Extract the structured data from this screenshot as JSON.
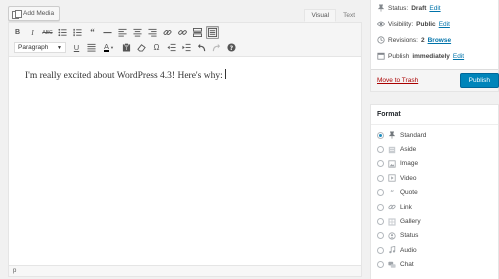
{
  "editor": {
    "add_media_label": "Add Media",
    "tabs": [
      {
        "label": "Visual",
        "active": true
      },
      {
        "label": "Text",
        "active": false
      }
    ],
    "format_select_value": "Paragraph",
    "content_text": "I'm really excited about WordPress 4.3! Here's why:",
    "status_path": "p",
    "toolbar_row1_icons": [
      "bold-icon",
      "italic-icon",
      "strikethrough-icon",
      "bullet-list-icon",
      "numbered-list-icon",
      "blockquote-icon",
      "horizontal-rule-icon",
      "align-left-icon",
      "align-center-icon",
      "align-right-icon",
      "link-icon",
      "unlink-icon",
      "read-more-icon",
      "toolbar-toggle-icon"
    ],
    "toolbar_row2_icons": [
      "underline-icon",
      "justify-icon",
      "text-color-icon",
      "paste-text-icon",
      "clear-formatting-icon",
      "special-character-icon",
      "outdent-icon",
      "indent-icon",
      "undo-icon",
      "redo-icon",
      "help-icon"
    ]
  },
  "publish": {
    "status_label": "Status:",
    "status_value": "Draft",
    "status_edit": "Edit",
    "visibility_label": "Visibility:",
    "visibility_value": "Public",
    "visibility_edit": "Edit",
    "revisions_label": "Revisions:",
    "revisions_value": "2",
    "revisions_browse": "Browse",
    "publish_label": "Publish",
    "publish_when": "immediately",
    "publish_edit": "Edit",
    "trash_label": "Move to Trash",
    "publish_button": "Publish"
  },
  "format": {
    "heading": "Format",
    "selected": "Standard",
    "options": [
      {
        "label": "Standard",
        "icon": "pin-icon"
      },
      {
        "label": "Aside",
        "icon": "aside-icon"
      },
      {
        "label": "Image",
        "icon": "image-icon"
      },
      {
        "label": "Video",
        "icon": "video-icon"
      },
      {
        "label": "Quote",
        "icon": "quote-icon"
      },
      {
        "label": "Link",
        "icon": "link-icon"
      },
      {
        "label": "Gallery",
        "icon": "gallery-icon"
      },
      {
        "label": "Status",
        "icon": "status-icon"
      },
      {
        "label": "Audio",
        "icon": "audio-icon"
      },
      {
        "label": "Chat",
        "icon": "chat-icon"
      }
    ]
  },
  "colors": {
    "accent": "#0073aa",
    "publish_button": "#0085ba",
    "trash": "#a00000"
  }
}
